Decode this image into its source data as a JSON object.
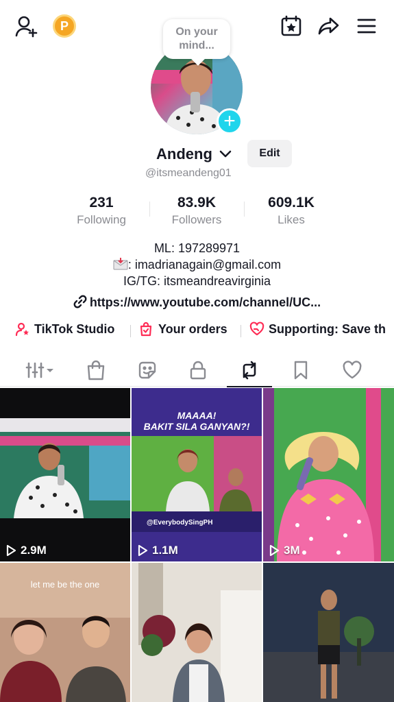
{
  "header": {
    "icons": [
      "add-friend-icon",
      "coin-icon",
      "calendar-star-icon",
      "share-icon",
      "menu-icon"
    ],
    "coin_letter": "P",
    "note_bubble": "On your mind..."
  },
  "profile": {
    "name": "Andeng",
    "edit_label": "Edit",
    "handle": "@itsmeandeng01"
  },
  "stats": [
    {
      "value": "231",
      "label": "Following"
    },
    {
      "value": "83.9K",
      "label": "Followers"
    },
    {
      "value": "609.1K",
      "label": "Likes"
    }
  ],
  "bio": {
    "line1": "ML: 197289971",
    "line2": ": imadrianagain@gmail.com",
    "line3": "IG/TG: itsmeandreavirginia",
    "link": "https://www.youtube.com/channel/UC..."
  },
  "shortcuts": [
    {
      "label": "TikTok Studio",
      "icon": "studio-icon"
    },
    {
      "label": "Your orders",
      "icon": "orders-icon"
    },
    {
      "label": "Supporting: Save th",
      "icon": "heart-hand-icon"
    }
  ],
  "tabs": [
    {
      "name": "videos-grid",
      "icon": "grid-icon"
    },
    {
      "name": "shop",
      "icon": "bag-icon"
    },
    {
      "name": "stickers",
      "icon": "sticker-icon"
    },
    {
      "name": "private",
      "icon": "lock-icon"
    },
    {
      "name": "reposts",
      "icon": "repost-icon",
      "active": true
    },
    {
      "name": "saved",
      "icon": "bookmark-icon"
    },
    {
      "name": "liked",
      "icon": "heart-icon"
    }
  ],
  "videos": [
    {
      "views": "2.9M"
    },
    {
      "views": "1.1M",
      "title": "MAAAA!\nBAKIT SILA GANYAN?!",
      "caption": "@EverybodySingPH"
    },
    {
      "views": "3M"
    },
    {
      "caption": "let me be the one"
    },
    {},
    {}
  ],
  "colors": {
    "accent": "#fe2c55",
    "plus_button": "#20d5ec",
    "coin": "#f5a623",
    "text_primary": "#161823",
    "text_secondary": "#8a8b91"
  }
}
